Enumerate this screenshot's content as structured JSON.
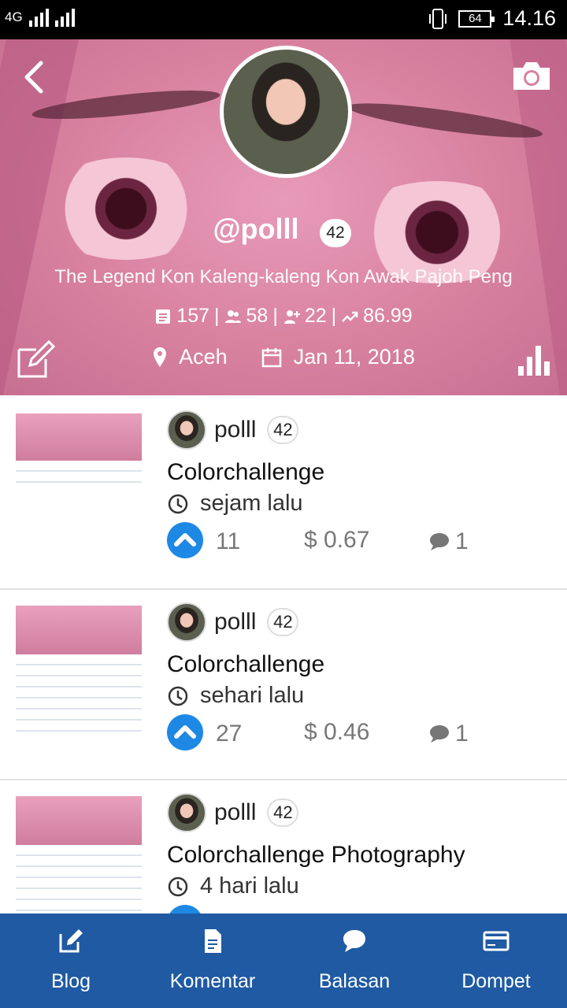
{
  "status_bar": {
    "network": "4G",
    "battery": "64",
    "time": "14.16"
  },
  "profile": {
    "username": "@polll",
    "reputation": "42",
    "bio": "The Legend Kon Kaleng-kaleng Kon Awak Pajoh Peng",
    "stats": {
      "posts": "157",
      "followers": "58",
      "following": "22",
      "power": "86.99"
    },
    "location": "Aceh",
    "joined": "Jan 11, 2018",
    "icons": [
      "back-icon",
      "camera-icon",
      "edit-icon",
      "bar-chart-icon",
      "post-icon",
      "followers-icon",
      "following-icon",
      "trending-icon",
      "location-pin-icon",
      "calendar-icon"
    ]
  },
  "posts": [
    {
      "author": "polll",
      "reputation": "42",
      "title": "Colorchallenge",
      "time": "sejam lalu",
      "votes": "11",
      "payout": "$ 0.67",
      "comments": "1"
    },
    {
      "author": "polll",
      "reputation": "42",
      "title": "Colorchallenge",
      "time": "sehari lalu",
      "votes": "27",
      "payout": "$ 0.46",
      "comments": "1"
    },
    {
      "author": "polll",
      "reputation": "42",
      "title": "Colorchallenge Photography",
      "time": "4 hari lalu",
      "votes": "",
      "payout": "",
      "comments": ""
    }
  ],
  "bottom_nav": [
    {
      "label": "Blog",
      "icon": "edit-icon"
    },
    {
      "label": "Komentar",
      "icon": "document-icon"
    },
    {
      "label": "Balasan",
      "icon": "chat-bubble-icon"
    },
    {
      "label": "Dompet",
      "icon": "wallet-card-icon"
    }
  ],
  "colors": {
    "accent": "#1e88e5",
    "nav": "#1f5aa3",
    "header": "#d8819f"
  }
}
